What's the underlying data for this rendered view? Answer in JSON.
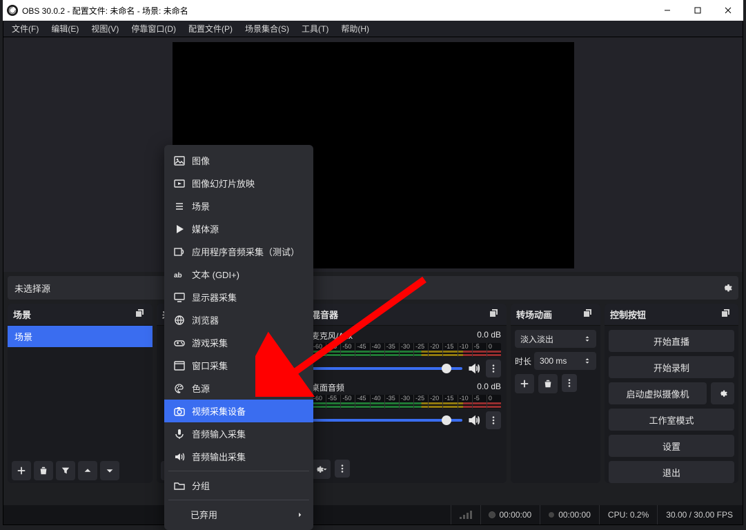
{
  "window": {
    "title": "OBS 30.0.2 - 配置文件: 未命名 - 场景: 未命名"
  },
  "menubar": [
    "文件(F)",
    "编辑(E)",
    "视图(V)",
    "停靠窗口(D)",
    "配置文件(P)",
    "场景集合(S)",
    "工具(T)",
    "帮助(H)"
  ],
  "noSource": {
    "label": "未选择源"
  },
  "docks": {
    "scenes": {
      "title": "场景",
      "item": "场景"
    },
    "sources": {
      "title": "来"
    },
    "mixer": {
      "title": "混音器",
      "tracks": [
        {
          "name": "麦克风/Aux",
          "db": "0.0 dB",
          "ticks": [
            "-60",
            "-55",
            "-50",
            "-45",
            "-40",
            "-35",
            "-30",
            "-25",
            "-20",
            "-15",
            "-10",
            "-5",
            "0"
          ]
        },
        {
          "name": "桌面音频",
          "db": "0.0 dB",
          "ticks": [
            "-60",
            "-55",
            "-50",
            "-45",
            "-40",
            "-35",
            "-30",
            "-25",
            "-20",
            "-15",
            "-10",
            "-5",
            "0"
          ]
        }
      ]
    },
    "trans": {
      "title": "转场动画",
      "select": "淡入淡出",
      "durLabel": "时长",
      "durVal": "300 ms"
    },
    "ctrl": {
      "title": "控制按钮",
      "buttons": {
        "stream": "开始直播",
        "record": "开始录制",
        "vcam": "启动虚拟摄像机",
        "studio": "工作室模式",
        "settings": "设置",
        "exit": "退出"
      }
    }
  },
  "context_menu": {
    "items": [
      {
        "icon": "image-icon",
        "label": "图像"
      },
      {
        "icon": "slideshow-icon",
        "label": "图像幻灯片放映"
      },
      {
        "icon": "list-icon",
        "label": "场景"
      },
      {
        "icon": "play-icon",
        "label": "媒体源"
      },
      {
        "icon": "app-audio-icon",
        "label": "应用程序音频采集（测试）"
      },
      {
        "icon": "text-ab-icon",
        "label": "文本 (GDI+)"
      },
      {
        "icon": "display-icon",
        "label": "显示器采集"
      },
      {
        "icon": "globe-icon",
        "label": "浏览器"
      },
      {
        "icon": "gamepad-icon",
        "label": "游戏采集"
      },
      {
        "icon": "window-icon",
        "label": "窗口采集"
      },
      {
        "icon": "palette-icon",
        "label": "色源"
      },
      {
        "icon": "camera-icon",
        "label": "视频采集设备",
        "hl": true
      },
      {
        "icon": "mic-icon",
        "label": "音频输入采集"
      },
      {
        "icon": "speaker-out-icon",
        "label": "音频输出采集"
      },
      {
        "sep": true
      },
      {
        "icon": "folder-icon",
        "label": "分组"
      },
      {
        "sep": true
      },
      {
        "submenu": true,
        "label": "已弃用"
      }
    ]
  },
  "status": {
    "live": "00:00:00",
    "rec": "00:00:00",
    "cpu": "CPU: 0.2%",
    "fps": "30.00 / 30.00 FPS"
  },
  "meta": {
    "highlighted_index": 11
  }
}
